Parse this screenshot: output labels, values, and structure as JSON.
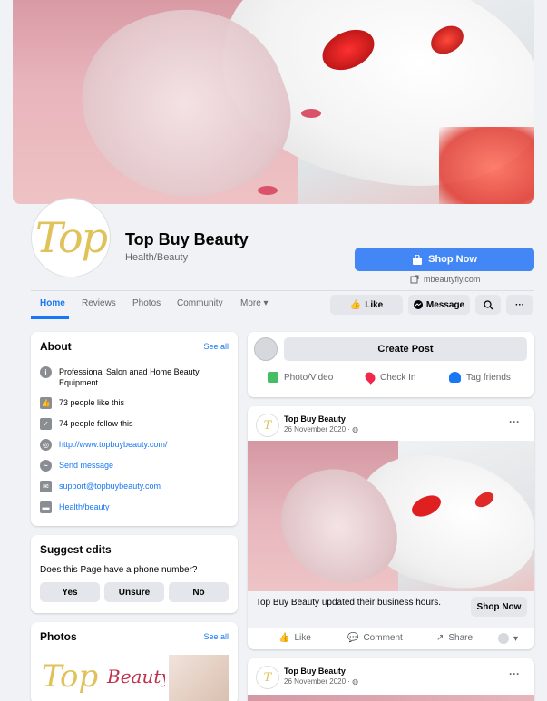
{
  "page": {
    "name": "Top Buy Beauty",
    "category": "Health/Beauty",
    "logo_text": "Top",
    "shop_button": "Shop Now",
    "website_short": "mbeautyfly.com"
  },
  "nav": {
    "tabs": [
      "Home",
      "Reviews",
      "Photos",
      "Community",
      "More ▾"
    ],
    "like": "Like",
    "message": "Message",
    "search_icon": "search-icon",
    "more_icon": "···"
  },
  "about": {
    "title": "About",
    "see_all": "See all",
    "items": [
      {
        "icon": "info-icon",
        "text": "Professional Salon anad Home Beauty Equipment"
      },
      {
        "icon": "thumbs-up-icon",
        "text": "73 people like this"
      },
      {
        "icon": "follow-icon",
        "text": "74 people follow this"
      },
      {
        "icon": "globe-icon",
        "text": "http://www.topbuybeauty.com/",
        "link": true
      },
      {
        "icon": "messenger-icon",
        "text": "Send message",
        "link": true
      },
      {
        "icon": "mail-icon",
        "text": "support@topbuybeauty.com",
        "link": true
      },
      {
        "icon": "tag-icon",
        "text": "Health/beauty",
        "link": true
      }
    ]
  },
  "suggest": {
    "title": "Suggest edits",
    "question": "Does this Page have a phone number?",
    "yes": "Yes",
    "unsure": "Unsure",
    "no": "No"
  },
  "photos": {
    "title": "Photos",
    "see_all": "See all",
    "thumb1_text": "Top",
    "thumb2_text": "Beauty"
  },
  "create_post": {
    "label": "Create Post",
    "photo_video": "Photo/Video",
    "check_in": "Check In",
    "tag_friends": "Tag friends"
  },
  "posts": [
    {
      "author": "Top Buy Beauty",
      "date": "26 November 2020 · ",
      "caption": "Top Buy Beauty updated their business hours.",
      "cta": "Shop Now",
      "like": "Like",
      "comment": "Comment",
      "share": "Share"
    },
    {
      "author": "Top Buy Beauty",
      "date": "26 November 2020 · "
    }
  ],
  "colors": {
    "accent": "#1877f2",
    "shop_button": "#4287f5",
    "logo_gold": "#e0c25a"
  }
}
